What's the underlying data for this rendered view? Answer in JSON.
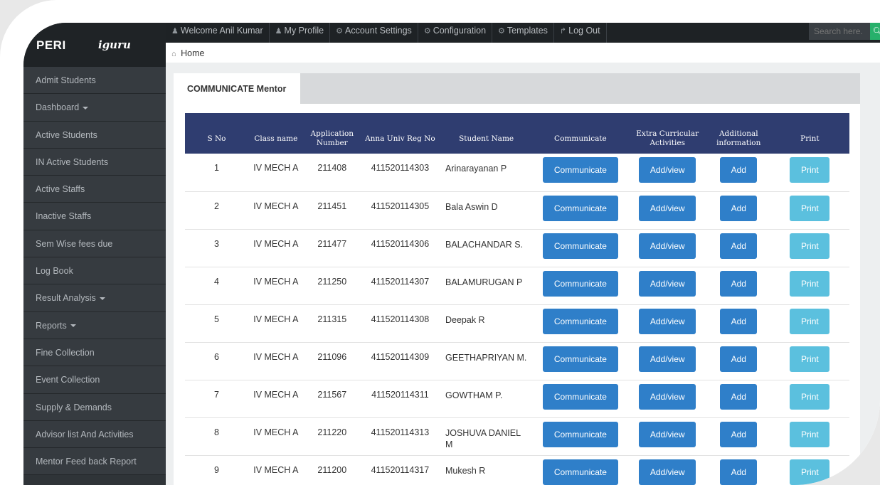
{
  "brand": {
    "name": "PERI",
    "product": "iguru"
  },
  "sidebar": {
    "items": [
      {
        "label": "Admit Students",
        "dropdown": false
      },
      {
        "label": "Dashboard",
        "dropdown": true
      },
      {
        "label": "Active Students",
        "dropdown": false
      },
      {
        "label": "IN Active Students",
        "dropdown": false
      },
      {
        "label": "Active Staffs",
        "dropdown": false
      },
      {
        "label": "Inactive Staffs",
        "dropdown": false
      },
      {
        "label": "Sem Wise fees due",
        "dropdown": false
      },
      {
        "label": "Log Book",
        "dropdown": false
      },
      {
        "label": "Result Analysis",
        "dropdown": true
      },
      {
        "label": "Reports",
        "dropdown": true
      },
      {
        "label": "Fine Collection",
        "dropdown": false
      },
      {
        "label": "Event Collection",
        "dropdown": false
      },
      {
        "label": "Supply & Demands",
        "dropdown": false
      },
      {
        "label": "Advisor list And Activities",
        "dropdown": false
      },
      {
        "label": "Mentor Feed back Report",
        "dropdown": false
      }
    ]
  },
  "topnav": {
    "items": [
      {
        "icon": "user-icon",
        "label": "Welcome Anil Kumar"
      },
      {
        "icon": "user-icon",
        "label": "My Profile"
      },
      {
        "icon": "gear-icon",
        "label": "Account Settings"
      },
      {
        "icon": "gear-icon",
        "label": "Configuration"
      },
      {
        "icon": "gear-icon",
        "label": "Templates"
      },
      {
        "icon": "share-icon",
        "label": "Log Out"
      }
    ],
    "search_placeholder": "Search here.",
    "search_icon": "search-icon"
  },
  "breadcrumb": {
    "icon": "home-icon",
    "label": "Home"
  },
  "tab": {
    "label": "COMMUNICATE Mentor"
  },
  "colors": {
    "header_bg": "#2f3d70",
    "primary_btn": "#2f7fc9",
    "print_btn": "#5bc0de",
    "search_btn": "#27b06b",
    "sidebar_bg": "#363b40"
  },
  "table": {
    "headers": [
      "S No",
      "Class name",
      "Application Number",
      "Anna Univ Reg No",
      "Student Name",
      "Communicate",
      "Extra Curricular Activities",
      "Additional information",
      "Print"
    ],
    "buttons": {
      "communicate": "Communicate",
      "activities": "Add/view",
      "additional": "Add",
      "print": "Print"
    },
    "rows": [
      {
        "sno": "1",
        "class": "IV MECH A",
        "app": "211408",
        "reg": "411520114303",
        "name": "Arinarayanan P"
      },
      {
        "sno": "2",
        "class": "IV MECH A",
        "app": "211451",
        "reg": "411520114305",
        "name": "Bala Aswin D"
      },
      {
        "sno": "3",
        "class": "IV MECH A",
        "app": "211477",
        "reg": "411520114306",
        "name": "BALACHANDAR S."
      },
      {
        "sno": "4",
        "class": "IV MECH A",
        "app": "211250",
        "reg": "411520114307",
        "name": "BALAMURUGAN P"
      },
      {
        "sno": "5",
        "class": "IV MECH A",
        "app": "211315",
        "reg": "411520114308",
        "name": "Deepak R"
      },
      {
        "sno": "6",
        "class": "IV MECH A",
        "app": "211096",
        "reg": "411520114309",
        "name": "GEETHAPRIYAN M."
      },
      {
        "sno": "7",
        "class": "IV MECH A",
        "app": "211567",
        "reg": "411520114311",
        "name": "GOWTHAM P."
      },
      {
        "sno": "8",
        "class": "IV MECH A",
        "app": "211220",
        "reg": "411520114313",
        "name": "JOSHUVA DANIEL M"
      },
      {
        "sno": "9",
        "class": "IV MECH A",
        "app": "211200",
        "reg": "411520114317",
        "name": "Mukesh R"
      }
    ]
  }
}
